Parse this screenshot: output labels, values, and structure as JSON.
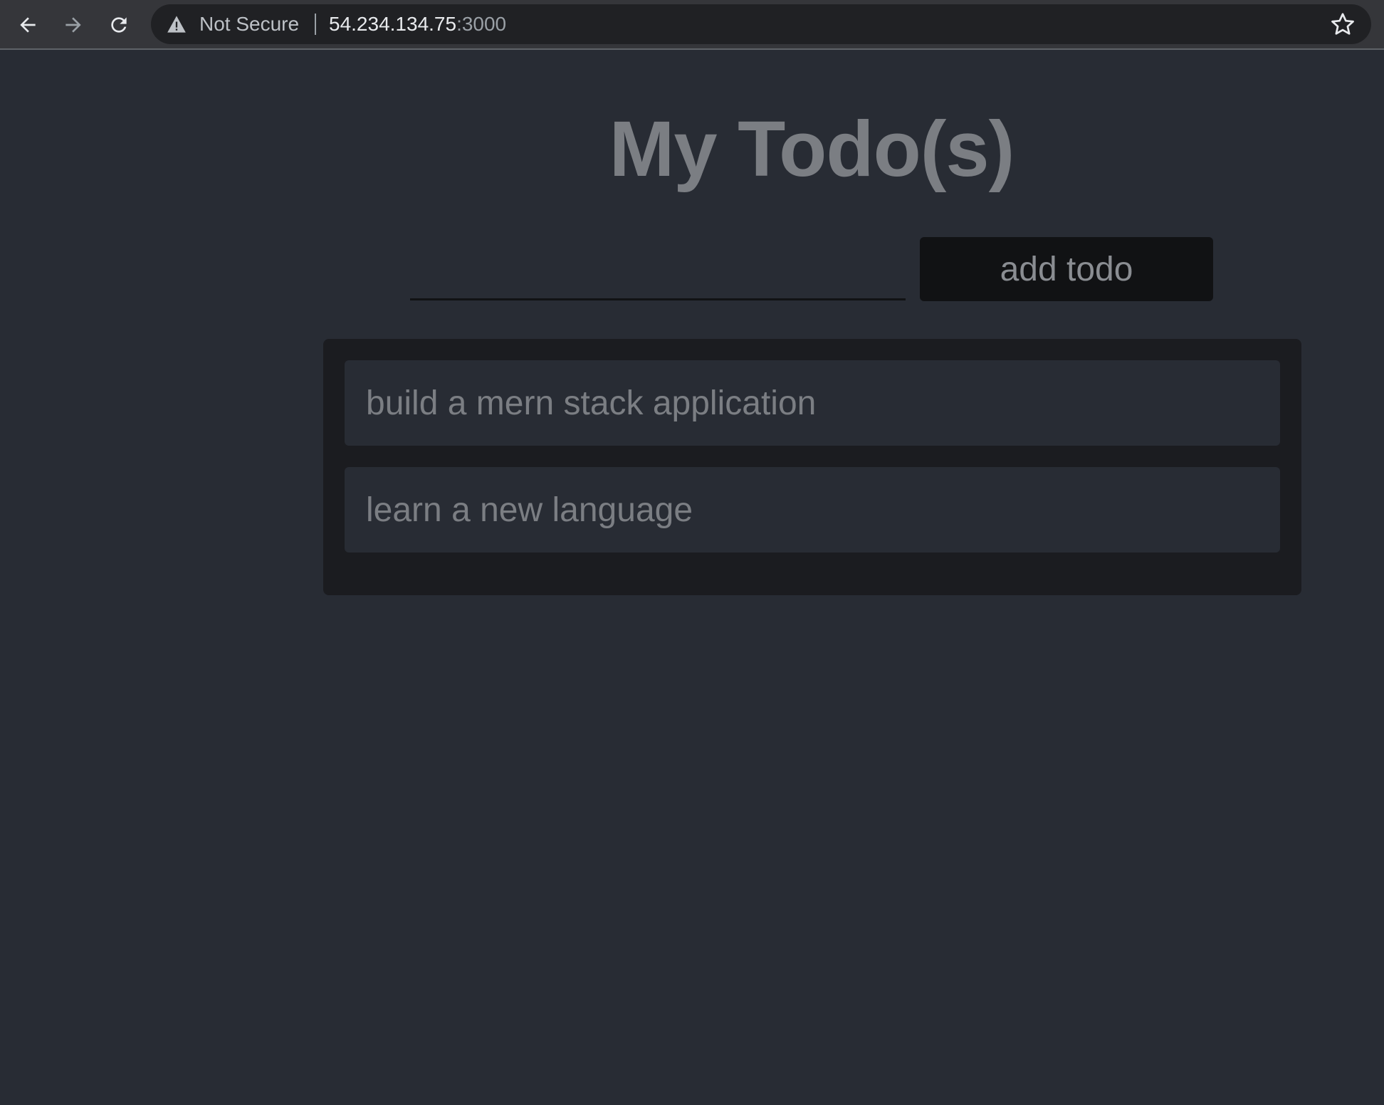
{
  "browser": {
    "security_label": "Not Secure",
    "url_host": "54.234.134.75",
    "url_port": ":3000",
    "icons": [
      "back-arrow-icon",
      "forward-arrow-icon",
      "reload-icon",
      "warning-icon",
      "star-icon"
    ]
  },
  "app": {
    "title": "My Todo(s)",
    "input": {
      "value": "",
      "placeholder": ""
    },
    "add_button_label": "add todo",
    "todos": [
      {
        "text": "build a mern stack application"
      },
      {
        "text": "learn a new language"
      }
    ]
  },
  "colors": {
    "page_background": "#282c34",
    "list_background": "#1b1c20",
    "button_background": "#111214",
    "text_muted": "#7b7e83"
  }
}
